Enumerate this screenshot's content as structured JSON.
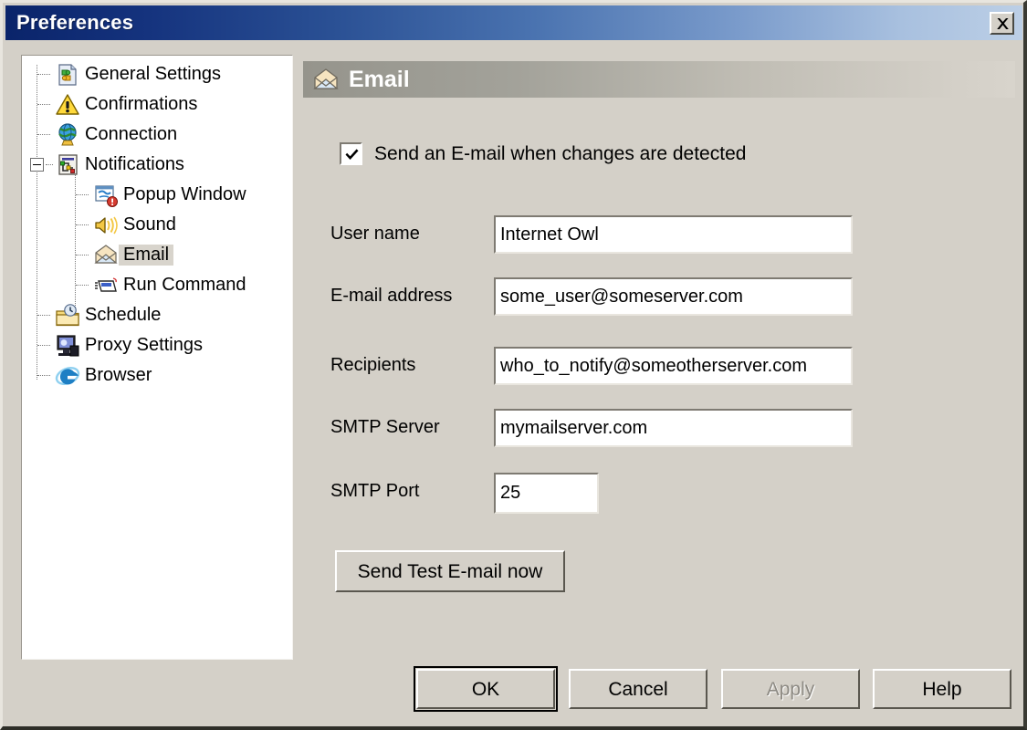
{
  "window": {
    "title": "Preferences",
    "close_icon": "close-icon",
    "bg_color": "#d4d0c8",
    "titlebar_color_start": "#0a246a",
    "titlebar_color_end": "#bccfe6"
  },
  "sidebar": {
    "items": [
      {
        "label": "General Settings",
        "icon": "document-puzzle-icon",
        "level": 0,
        "selected": false,
        "expander": null
      },
      {
        "label": "Confirmations",
        "icon": "warning-triangle-icon",
        "level": 0,
        "selected": false,
        "expander": null
      },
      {
        "label": "Connection",
        "icon": "globe-icon",
        "level": 0,
        "selected": false,
        "expander": null
      },
      {
        "label": "Notifications",
        "icon": "network-nodes-icon",
        "level": 0,
        "selected": false,
        "expander": "minus"
      },
      {
        "label": "Popup Window",
        "icon": "popup-window-icon",
        "level": 1,
        "selected": false,
        "expander": null
      },
      {
        "label": "Sound",
        "icon": "speaker-icon",
        "level": 1,
        "selected": false,
        "expander": null
      },
      {
        "label": "Email",
        "icon": "envelope-icon",
        "level": 1,
        "selected": true,
        "expander": null
      },
      {
        "label": "Run Command",
        "icon": "run-command-icon",
        "level": 1,
        "selected": false,
        "expander": null
      },
      {
        "label": "Schedule",
        "icon": "schedule-folder-icon",
        "level": 0,
        "selected": false,
        "expander": null
      },
      {
        "label": "Proxy Settings",
        "icon": "monitor-icon",
        "level": 0,
        "selected": false,
        "expander": null
      },
      {
        "label": "Browser",
        "icon": "internet-explorer-icon",
        "level": 0,
        "selected": false,
        "expander": null
      }
    ]
  },
  "pane": {
    "header_title": "Email",
    "header_icon": "envelope-icon",
    "enable_checkbox": {
      "label": "Send an E-mail when changes are detected",
      "checked": true
    },
    "fields": [
      {
        "label": "User name",
        "value": "Internet Owl",
        "placeholder": ""
      },
      {
        "label": "E-mail address",
        "value": "some_user@someserver.com",
        "placeholder": ""
      },
      {
        "label": "Recipients",
        "value": "who_to_notify@someotherserver.com",
        "placeholder": ""
      },
      {
        "label": "SMTP Server",
        "value": "mymailserver.com",
        "placeholder": ""
      },
      {
        "label": "SMTP Port",
        "value": "25",
        "placeholder": ""
      }
    ],
    "test_button": "Send Test E-mail now"
  },
  "footer": {
    "buttons": [
      {
        "label": "OK",
        "default": true,
        "disabled": false
      },
      {
        "label": "Cancel",
        "default": false,
        "disabled": false
      },
      {
        "label": "Apply",
        "default": false,
        "disabled": true
      },
      {
        "label": "Help",
        "default": false,
        "disabled": false
      }
    ]
  }
}
